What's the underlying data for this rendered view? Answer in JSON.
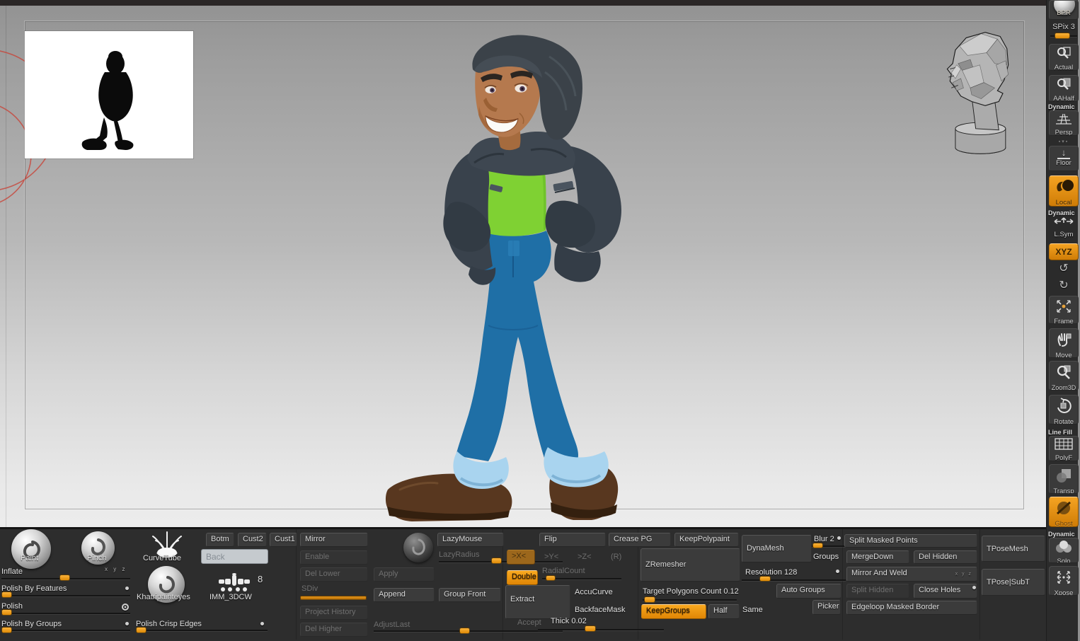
{
  "sidebar": {
    "groups": {
      "dynamic": "Dynamic",
      "line_fill": "Line Fill"
    },
    "items": {
      "bpr": "BPR",
      "spix": "SPix 3",
      "actual": "Actual",
      "aahalf": "AAHalf",
      "persp": "Persp",
      "floor": "Floor",
      "local": "Local",
      "lsym": "L.Sym",
      "xyz": "XYZ",
      "frame": "Frame",
      "move": "Move",
      "zoom3d": "Zoom3D",
      "rotate": "Rotate",
      "polyf": "PolyF",
      "transp": "Transp",
      "ghost": "Ghost",
      "solo": "Solo",
      "xpose": "Xpose"
    }
  },
  "shelf": {
    "brushes": {
      "paint": "Paint",
      "pinch": "Pinch",
      "curvetube": "CurveTube",
      "khatripainteyes": "Khatripainteyes",
      "imm": "IMM_3DCW",
      "imm_count": "8"
    },
    "customs": {
      "botm": "Botm",
      "cust2": "Cust2",
      "cust1": "Cust1",
      "back": "Back"
    },
    "left_sliders": {
      "inflate": "Inflate",
      "xyz_mini": "x y z",
      "polish_by_features": "Polish By Features",
      "polish": "Polish",
      "polish_by_groups": "Polish By Groups",
      "polish_crisp_edges": "Polish Crisp Edges"
    },
    "geometry": {
      "mirror": "Mirror",
      "enable": "Enable",
      "del_lower": "Del Lower",
      "apply": "Apply",
      "sdiv": "SDiv",
      "append": "Append",
      "group_front": "Group Front",
      "project_history": "Project History",
      "del_higher": "Del Higher",
      "adjust_last": "AdjustLast",
      "lazymouse": "LazyMouse",
      "lazyradius": "LazyRadius"
    },
    "deform": {
      "flip": "Flip",
      "crease_pg": "Crease PG",
      "keep_polypaint": "KeepPolypaint",
      "mx": ">X<",
      "my": ">Y<",
      "mz": ">Z<",
      "mr": "(R)",
      "radial_count": "RadialCount",
      "double": "Double",
      "extract": "Extract",
      "accu_curve": "AccuCurve",
      "backface_mask": "BackfaceMask",
      "accept": "Accept",
      "thick": "Thick 0.02"
    },
    "zremesher": {
      "title": "ZRemesher",
      "target": "Target Polygons Count 0.12",
      "keep_groups": "KeepGroups",
      "half": "Half",
      "same": "Same"
    },
    "dynamesh": {
      "title": "DynaMesh",
      "blur": "Blur 2",
      "groups": "Groups",
      "resolution": "Resolution 128",
      "auto_groups": "Auto Groups",
      "picker": "Picker"
    },
    "modify_topology": {
      "split_masked_points": "Split Masked Points",
      "merge_down": "MergeDown",
      "del_hidden": "Del Hidden",
      "mirror_and_weld": "Mirror And Weld",
      "xyz_mini": "x y z",
      "split_hidden": "Split Hidden",
      "close_holes": "Close Holes",
      "edgeloop_masked_border": "Edgeloop Masked Border",
      "tpose_mesh": "TPoseMesh",
      "tpose_subt": "TPose|SubT"
    }
  },
  "colors": {
    "accent_orange": "#f09a18",
    "muted_active_orange": "#9c671c",
    "shelf_bg": "#2d2d2d",
    "sidebar_bg": "#2b2b2b",
    "canvas_top": "#939393",
    "canvas_bottom": "#ececec",
    "model_shirt_green": "#7fd133",
    "model_jacket_slate": "#39424c",
    "model_jeans_blue": "#1f6fa6",
    "model_cuff_blue": "#a9d4ef",
    "model_shoe_brown": "#58371f",
    "model_skin": "#b5794e",
    "model_hair": "#3b4249"
  }
}
